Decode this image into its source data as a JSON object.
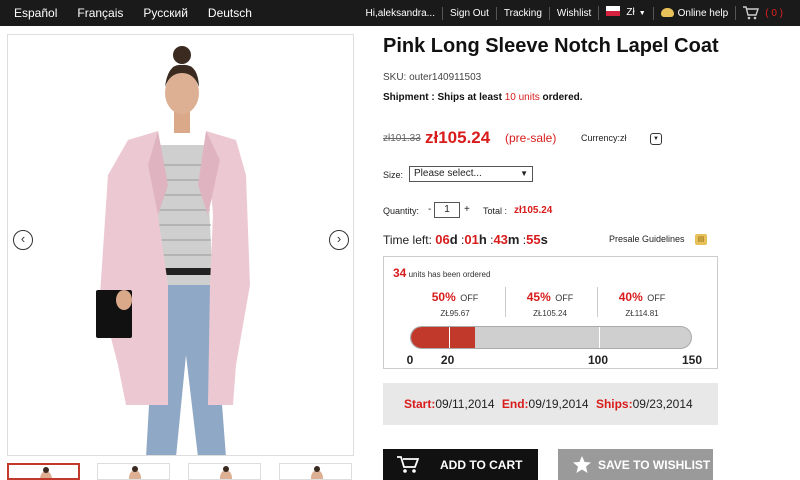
{
  "topbar": {
    "languages": [
      "Español",
      "Français",
      "Русский",
      "Deutsch"
    ],
    "greeting": "Hi,aleksandra...",
    "sign_out": "Sign Out",
    "tracking": "Tracking",
    "wishlist": "Wishlist",
    "currency_code": "Zł",
    "online_help": "Online help",
    "cart_count": "( 0 )"
  },
  "product": {
    "title": "Pink Long Sleeve Notch Lapel Coat",
    "sku": "SKU: outer140911503",
    "shipment_prefix": "Shipment : Ships at least ",
    "shipment_units": "10 units",
    "shipment_suffix": " ordered.",
    "old_price": "zł101.33",
    "price": "zł105.24",
    "presale_tag": "(pre-sale)",
    "currency_label": "Currency:zł",
    "size_label": "Size:",
    "size_placeholder": "Please select...",
    "quantity_label": "Quantity:",
    "quantity_minus": "-",
    "quantity_value": "1",
    "quantity_plus": "+",
    "total_label": "Total :",
    "total_value": "zł105.24",
    "presale_guidelines": "Presale Guidelines"
  },
  "timer": {
    "label": "Time left:",
    "days": "06",
    "days_unit": "d",
    "hours": "01",
    "hours_unit": "h",
    "minutes": "43",
    "minutes_unit": "m",
    "seconds": "55",
    "seconds_unit": "s"
  },
  "progress": {
    "ordered_count": "34",
    "ordered_text": "units has been ordered",
    "tiers": [
      {
        "pct": "50%",
        "off": "OFF",
        "price": "ZŁ95.67"
      },
      {
        "pct": "45%",
        "off": "OFF",
        "price": "ZŁ105.24"
      },
      {
        "pct": "40%",
        "off": "OFF",
        "price": "ZŁ114.81"
      }
    ],
    "scale_labels": [
      "0",
      "20",
      "100",
      "150"
    ],
    "scale_values": [
      0,
      20,
      100,
      150
    ],
    "scale_max": 150,
    "current": 34
  },
  "dates": {
    "start_label": "Start:",
    "start_value": "09/11,2014",
    "end_label": "End:",
    "end_value": "09/19,2014",
    "ships_label": "Ships:",
    "ships_value": "09/23,2014"
  },
  "buttons": {
    "add_to_cart": "ADD TO CART",
    "save_to_wishlist": "SAVE TO WISHLIST"
  },
  "colors": {
    "accent_red": "#d81c1c",
    "topbar_bg": "#1a1a1a",
    "coat_pink": "#ecc9d2"
  }
}
